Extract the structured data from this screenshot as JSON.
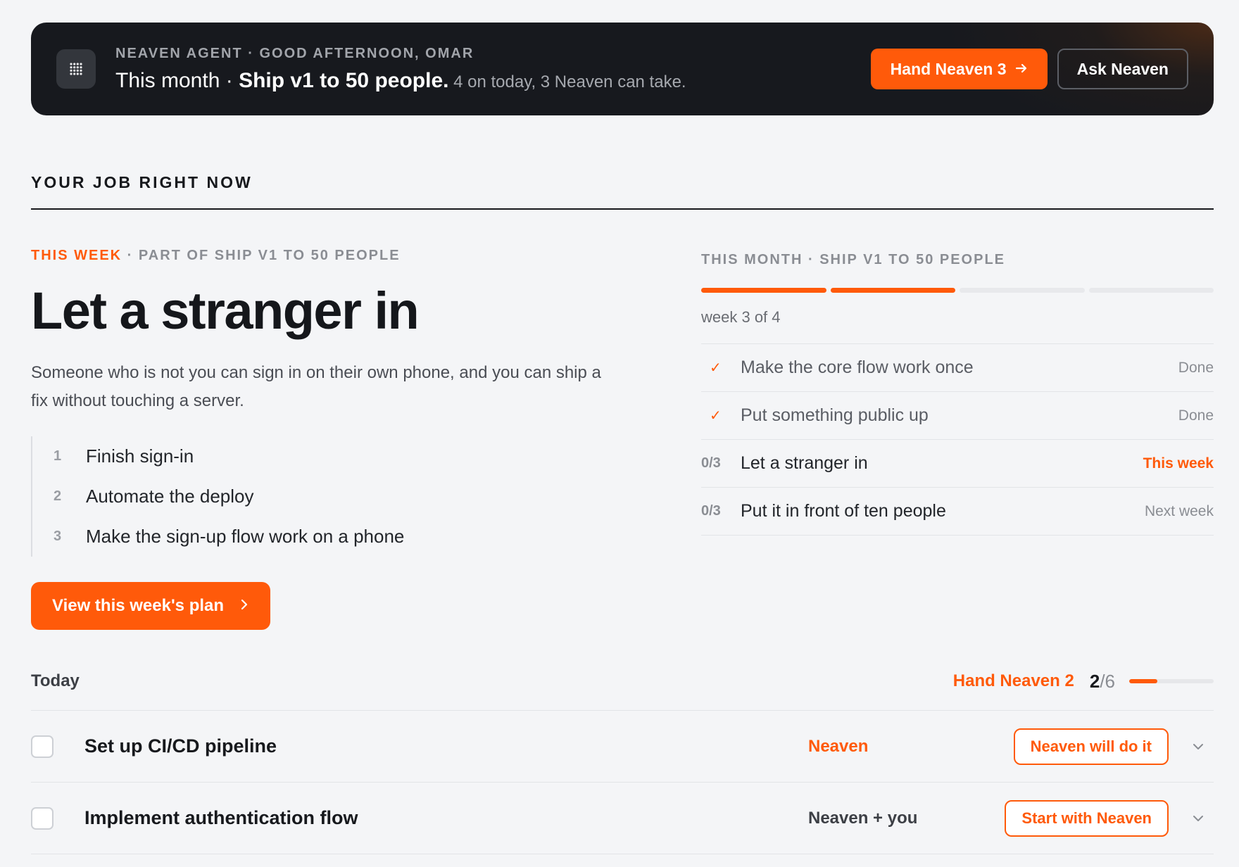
{
  "banner": {
    "eyebrow": "NEAVEN AGENT · GOOD AFTERNOON, OMAR",
    "headline_prefix": "This month · ",
    "headline_goal": "Ship v1 to 50 people.",
    "headline_sub": " 4 on today, 3 Neaven can take.",
    "primary_label": "Hand Neaven 3",
    "secondary_label": "Ask Neaven",
    "logo_icon": "dot-grid-icon",
    "arrow_icon": "arrow-right-icon"
  },
  "section": {
    "title": "YOUR JOB RIGHT NOW"
  },
  "week": {
    "eyebrow_accent": "THIS WEEK",
    "eyebrow_rest": " · PART OF SHIP V1 TO 50 PEOPLE",
    "title": "Let a stranger in",
    "description": "Someone who is not you can sign in on their own phone, and you can ship a fix without touching a server.",
    "steps": [
      {
        "num": "1",
        "label": "Finish sign-in"
      },
      {
        "num": "2",
        "label": "Automate the deploy"
      },
      {
        "num": "3",
        "label": "Make the sign-up flow work on a phone"
      }
    ],
    "plan_button": "View this week's plan"
  },
  "month": {
    "eyebrow": "THIS MONTH · SHIP V1 TO 50 PEOPLE",
    "progress": {
      "completed_weeks": 2,
      "total_weeks": 4
    },
    "week_label": "week 3 of 4",
    "milestones": [
      {
        "mark": "✓",
        "label": "Make the core flow work once",
        "status": "Done"
      },
      {
        "mark": "✓",
        "label": "Put something public up",
        "status": "Done"
      },
      {
        "mark": "0/3",
        "label": "Let a stranger in",
        "status": "This week"
      },
      {
        "mark": "0/3",
        "label": "Put it in front of ten people",
        "status": "Next week"
      }
    ]
  },
  "today": {
    "title": "Today",
    "hand_label": "Hand Neaven 2",
    "done": "2",
    "total": "/6",
    "progress_fraction": 0.33,
    "tasks": [
      {
        "title": "Set up CI/CD pipeline",
        "owner": "Neaven",
        "action": "Neaven will do it"
      },
      {
        "title": "Implement authentication flow",
        "owner": "Neaven + you",
        "action": "Start with Neaven"
      }
    ]
  },
  "colors": {
    "accent": "#ff5a0a",
    "banner_bg": "#17191e",
    "page_bg": "#f4f5f7"
  }
}
